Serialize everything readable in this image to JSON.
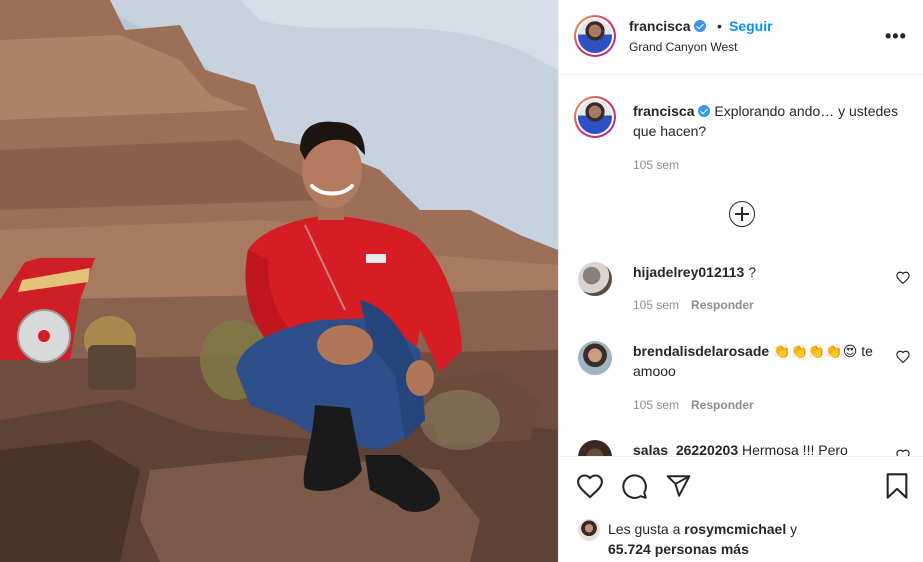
{
  "post": {
    "username": "francisca",
    "follow_label": "Seguir",
    "separator": "•",
    "location": "Grand Canyon West",
    "more_label": "•••",
    "caption_text": "Explorando ando… y ustedes que hacen?",
    "caption_time": "105 sem"
  },
  "comments": [
    {
      "username": "hijadelrey012113",
      "text": "?",
      "time": "105 sem",
      "reply": "Responder"
    },
    {
      "username": "brendalisdelarosade",
      "text": "👏👏👏👏😍 te amooo",
      "time": "105 sem",
      "reply": "Responder"
    },
    {
      "username": "salas_26220203",
      "text": "Hermosa !!! Pero"
    }
  ],
  "likes": {
    "prefix": "Les gusta a",
    "user": "rosymcmichael",
    "connector": "y",
    "count_text": "65.724 personas más"
  },
  "icons": [
    "verified-badge-icon",
    "more-options-icon",
    "load-more-comments-icon",
    "like-heart-icon",
    "comment-bubble-icon",
    "share-send-icon",
    "save-bookmark-icon"
  ],
  "colors": {
    "link_blue": "#0095f6",
    "verified_blue": "#3897f0",
    "muted": "#8e8e8e",
    "text": "#262626"
  }
}
